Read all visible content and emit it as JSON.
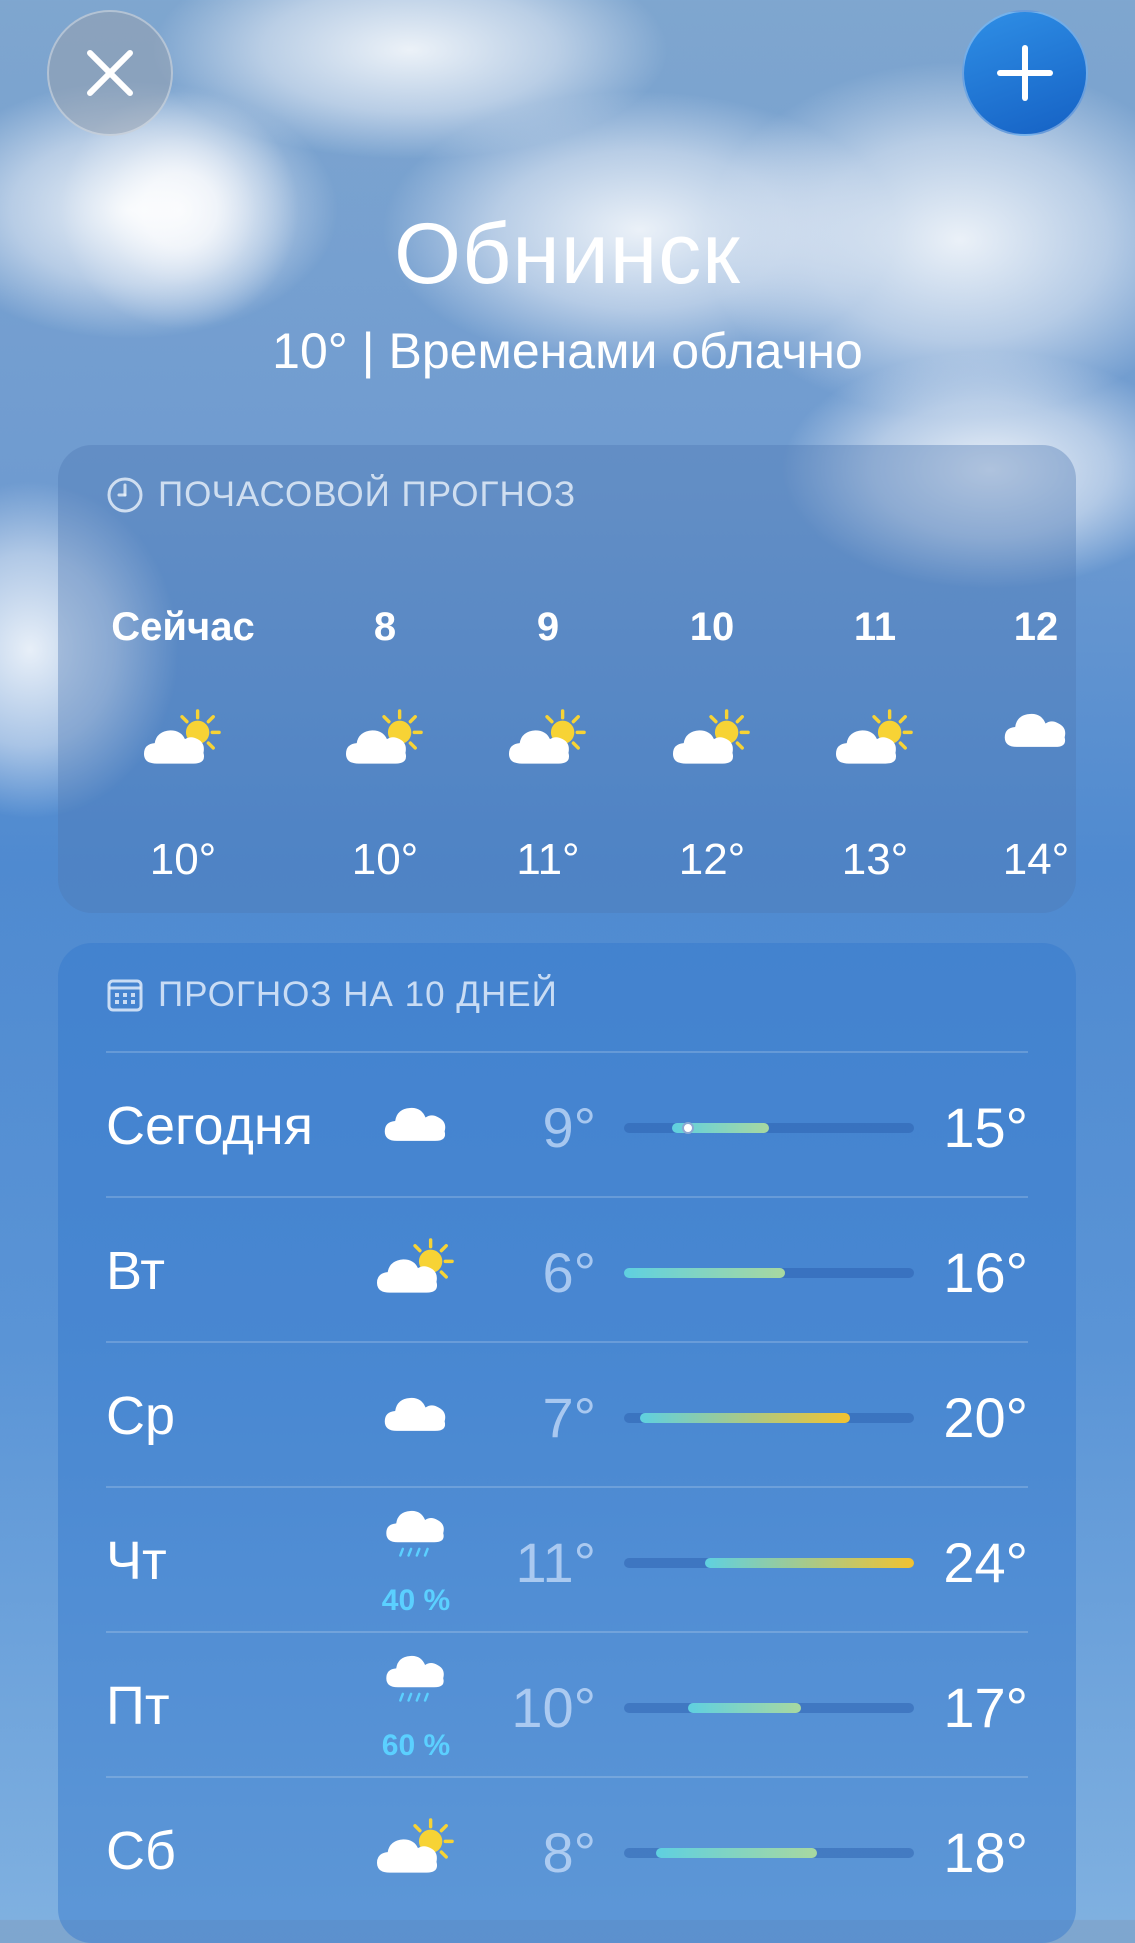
{
  "header": {
    "city": "Обнинск",
    "current": "10° | Временами облачно"
  },
  "hourly": {
    "title": "ПОЧАСОВОЙ ПРОГНОЗ",
    "items": [
      {
        "label": "Сейчас",
        "icon": "partly-cloudy-icon",
        "temp": "10°"
      },
      {
        "label": "8",
        "icon": "partly-cloudy-icon",
        "temp": "10°"
      },
      {
        "label": "9",
        "icon": "partly-cloudy-icon",
        "temp": "11°"
      },
      {
        "label": "10",
        "icon": "partly-cloudy-icon",
        "temp": "12°"
      },
      {
        "label": "11",
        "icon": "partly-cloudy-icon",
        "temp": "13°"
      },
      {
        "label": "12",
        "icon": "cloud-icon",
        "temp": "14°"
      }
    ]
  },
  "daily": {
    "title": "ПРОГНОЗ НА 10 ДНЕЙ",
    "range_min": 6,
    "range_max": 24,
    "current_temp": 10,
    "rows": [
      {
        "day": "Сегодня",
        "icon": "cloud-icon",
        "pop": "",
        "low": "9°",
        "high": "15°",
        "low_v": 9,
        "high_v": 15
      },
      {
        "day": "Вт",
        "icon": "partly-cloudy-icon",
        "pop": "",
        "low": "6°",
        "high": "16°",
        "low_v": 6,
        "high_v": 16
      },
      {
        "day": "Ср",
        "icon": "cloud-icon",
        "pop": "",
        "low": "7°",
        "high": "20°",
        "low_v": 7,
        "high_v": 20
      },
      {
        "day": "Чт",
        "icon": "rain-icon",
        "pop": "40 %",
        "low": "11°",
        "high": "24°",
        "low_v": 11,
        "high_v": 24
      },
      {
        "day": "Пт",
        "icon": "rain-icon",
        "pop": "60 %",
        "low": "10°",
        "high": "17°",
        "low_v": 10,
        "high_v": 17
      },
      {
        "day": "Сб",
        "icon": "partly-cloudy-icon",
        "pop": "",
        "low": "8°",
        "high": "18°",
        "low_v": 8,
        "high_v": 18
      }
    ]
  },
  "colors": {
    "cool": "#5fd0e0",
    "mild": "#a8d8a0",
    "warm": "#f2c230",
    "sun": "#f7d335"
  }
}
